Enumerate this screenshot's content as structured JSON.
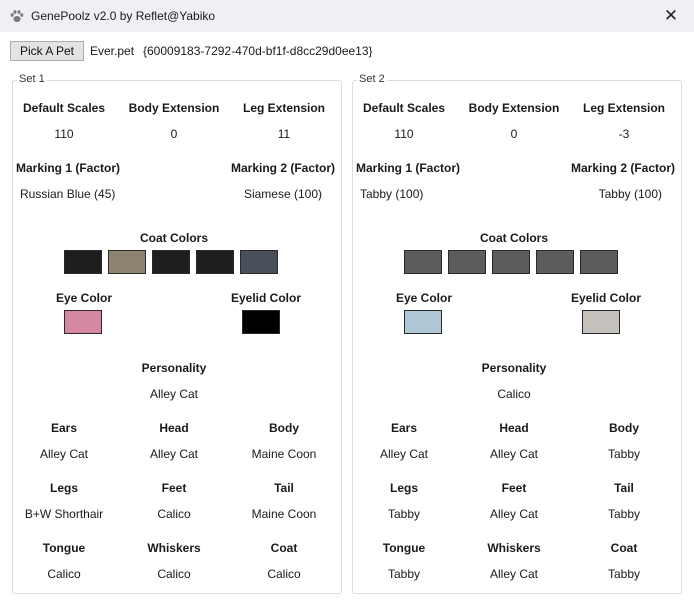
{
  "window": {
    "title": "GenePoolz v2.0 by Reflet@Yabiko",
    "close_glyph": "✕",
    "app_icon": "paw-icon"
  },
  "toolbar": {
    "pick_label": "Pick A Pet",
    "filename": "Ever.pet",
    "guid": "{60009183-7292-470d-bf1f-d8cc29d0ee13}"
  },
  "labels": {
    "default_scales": "Default Scales",
    "body_extension": "Body Extension",
    "leg_extension": "Leg Extension",
    "marking1": "Marking 1 (Factor)",
    "marking2": "Marking 2 (Factor)",
    "coat_colors": "Coat Colors",
    "eye_color": "Eye Color",
    "eyelid_color": "Eyelid Color",
    "personality": "Personality",
    "ears": "Ears",
    "head": "Head",
    "body": "Body",
    "legs": "Legs",
    "feet": "Feet",
    "tail": "Tail",
    "tongue": "Tongue",
    "whiskers": "Whiskers",
    "coat": "Coat"
  },
  "set1": {
    "title": "Set 1",
    "default_scales": "110",
    "body_extension": "0",
    "leg_extension": "11",
    "marking1": "Russian Blue (45)",
    "marking2": "Siamese (100)",
    "coat_colors": [
      "#1e1e1e",
      "#8c8470",
      "#1e1e1e",
      "#1e1e1e",
      "#4a505a"
    ],
    "eye_color": "#d4879e",
    "eyelid_color": "#000000",
    "personality": "Alley Cat",
    "ears": "Alley Cat",
    "head": "Alley Cat",
    "body": "Maine Coon",
    "legs": "B+W Shorthair",
    "feet": "Calico",
    "tail": "Maine Coon",
    "tongue": "Calico",
    "whiskers": "Calico",
    "coat": "Calico"
  },
  "set2": {
    "title": "Set 2",
    "default_scales": "110",
    "body_extension": "0",
    "leg_extension": "-3",
    "marking1": "Tabby (100)",
    "marking2": "Tabby (100)",
    "coat_colors": [
      "#5c5c5c",
      "#5c5c5c",
      "#5c5c5c",
      "#5c5c5c",
      "#5c5c5c"
    ],
    "eye_color": "#aec6d6",
    "eyelid_color": "#c4c0bb",
    "personality": "Calico",
    "ears": "Alley Cat",
    "head": "Alley Cat",
    "body": "Tabby",
    "legs": "Tabby",
    "feet": "Alley Cat",
    "tail": "Tabby",
    "tongue": "Tabby",
    "whiskers": "Alley Cat",
    "coat": "Tabby"
  }
}
